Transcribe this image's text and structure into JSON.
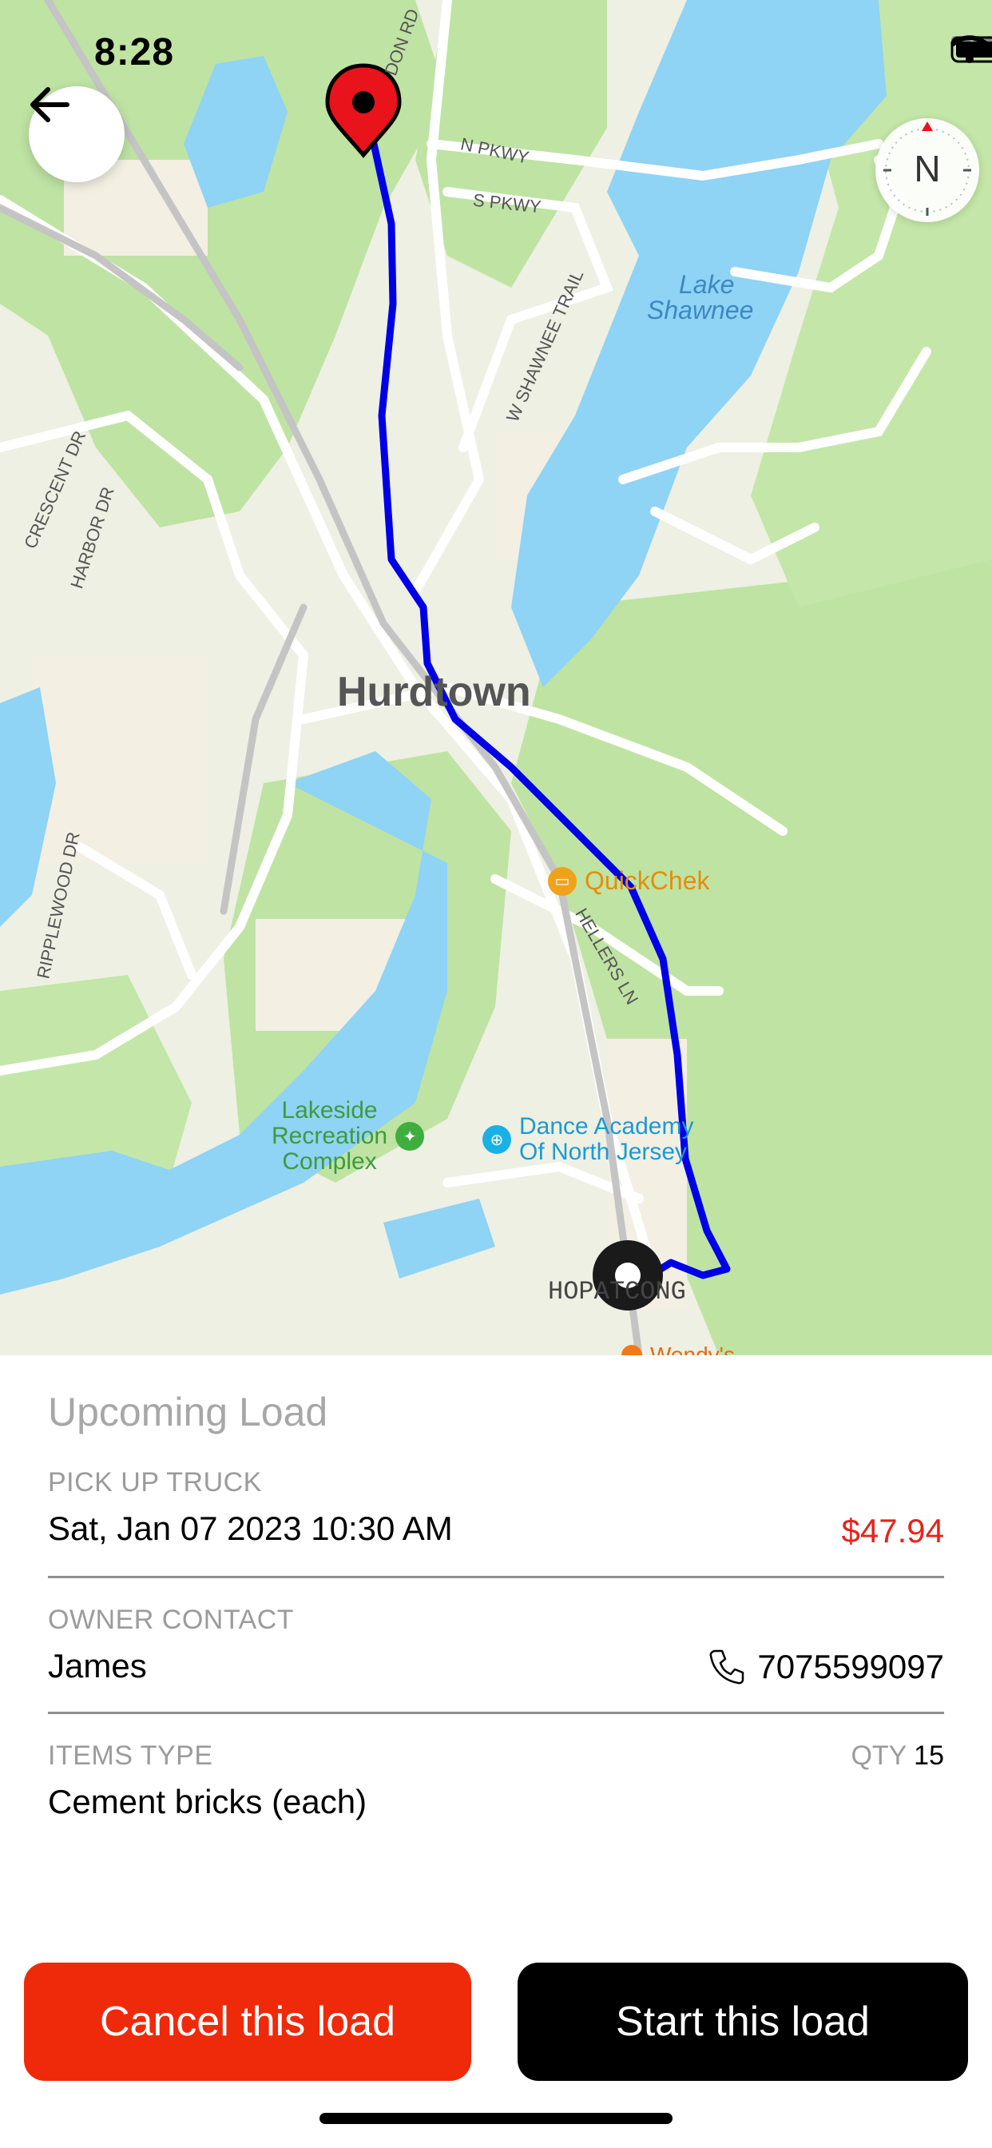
{
  "status_bar": {
    "time": "8:28"
  },
  "map": {
    "place_label": "Hurdtown",
    "lake_label": [
      "Lake",
      "Shawnee"
    ],
    "roads": {
      "n_pkwy": "N PKWY",
      "s_pkwy": "S PKWY",
      "shawnee_trail": "W SHAWNEE TRAIL",
      "crescent": "CRESCENT DR",
      "harbor": "HARBOR DR",
      "ripplewood": "RIPPLEWOOD DR",
      "hellers": "HELLERS LN",
      "top_road": "DON RD",
      "hopatcong": "HOPATCONG"
    },
    "pois": {
      "quickchek": "QuickChek",
      "lakeside": [
        "Lakeside",
        "Recreation",
        "Complex"
      ],
      "dance": [
        "Dance Academy",
        "Of North Jersey"
      ],
      "wendys": "Wendy's"
    },
    "compass_letter": "N",
    "route_color": "#0000e6",
    "pin_color": "#e8131b"
  },
  "panel": {
    "title": "Upcoming Load",
    "pickup_label": "PICK UP TRUCK",
    "pickup_datetime": "Sat, Jan 07 2023 10:30 AM",
    "price": "$47.94",
    "owner_label": "OWNER CONTACT",
    "owner_name": "James",
    "owner_phone": "7075599097",
    "items_label": "ITEMS TYPE",
    "items_value": "Cement bricks (each)",
    "qty_label": "QTY",
    "qty_value": "15"
  },
  "actions": {
    "cancel_label": "Cancel this load",
    "start_label": "Start this load",
    "cancel_color": "#ee2a0b",
    "start_color": "#000000"
  }
}
